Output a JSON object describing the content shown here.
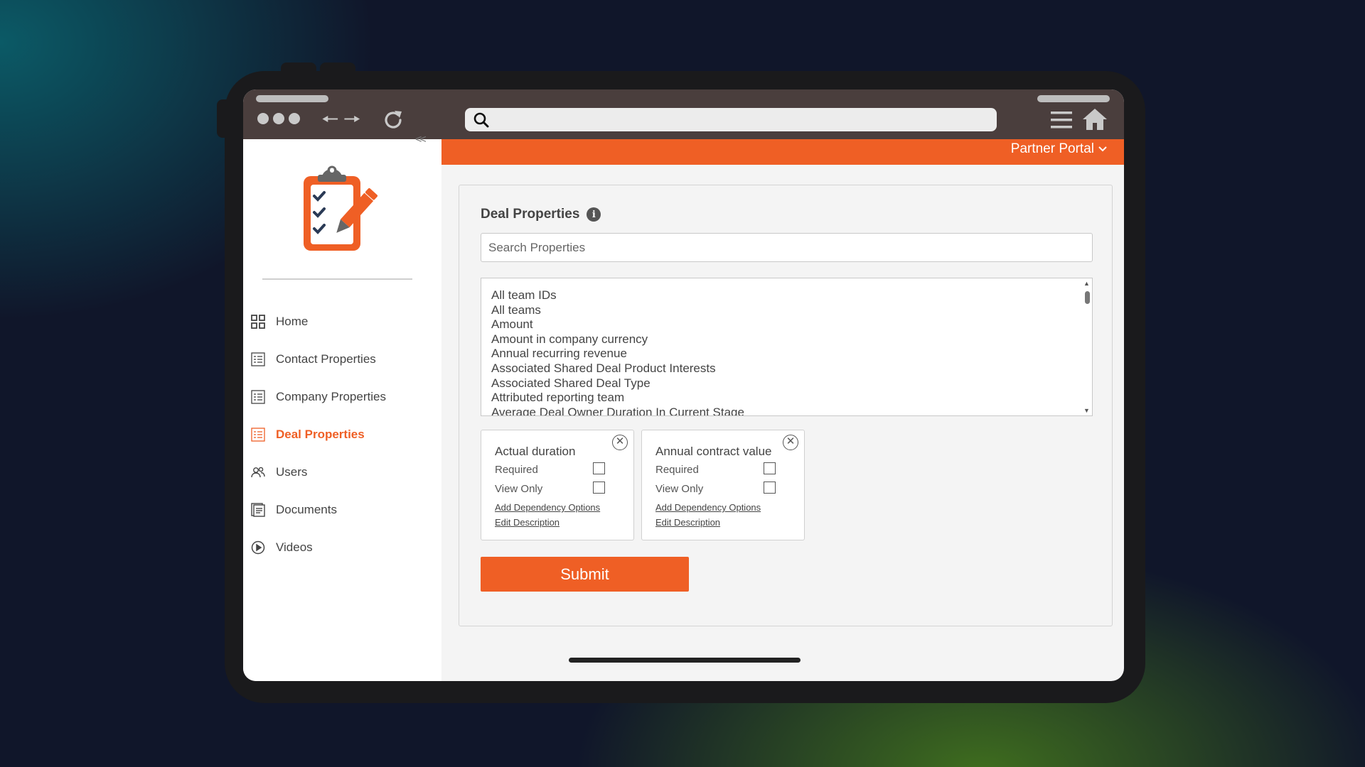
{
  "header": {
    "portal_label": "Partner Portal"
  },
  "sidebar": {
    "collapse_label": "<<",
    "items": [
      {
        "label": "Home",
        "icon": "grid-icon",
        "active": false
      },
      {
        "label": "Contact Properties",
        "icon": "list-icon",
        "active": false
      },
      {
        "label": "Company Properties",
        "icon": "list-icon",
        "active": false
      },
      {
        "label": "Deal Properties",
        "icon": "list-icon",
        "active": true
      },
      {
        "label": "Users",
        "icon": "users-icon",
        "active": false
      },
      {
        "label": "Documents",
        "icon": "document-icon",
        "active": false
      },
      {
        "label": "Videos",
        "icon": "play-icon",
        "active": false
      }
    ]
  },
  "main": {
    "title": "Deal Properties",
    "info_glyph": "i",
    "search_placeholder": "Search Properties",
    "properties": [
      "All team IDs",
      "All teams",
      "Amount",
      "Amount in company currency",
      "Annual recurring revenue",
      "Associated Shared Deal Product Interests",
      "Associated Shared Deal Type",
      "Attributed reporting team",
      "Average Deal Owner Duration In Current Stage"
    ],
    "selected": [
      {
        "name": "Actual duration",
        "required_label": "Required",
        "view_only_label": "View Only",
        "dependency_link": "Add Dependency Options",
        "description_link": "Edit Description"
      },
      {
        "name": "Annual contract value",
        "required_label": "Required",
        "view_only_label": "View Only",
        "dependency_link": "Add Dependency Options",
        "description_link": "Edit Description"
      }
    ],
    "submit_label": "Submit"
  },
  "colors": {
    "accent": "#ef5f25",
    "chrome": "#4a3e3d",
    "text": "#444444"
  }
}
